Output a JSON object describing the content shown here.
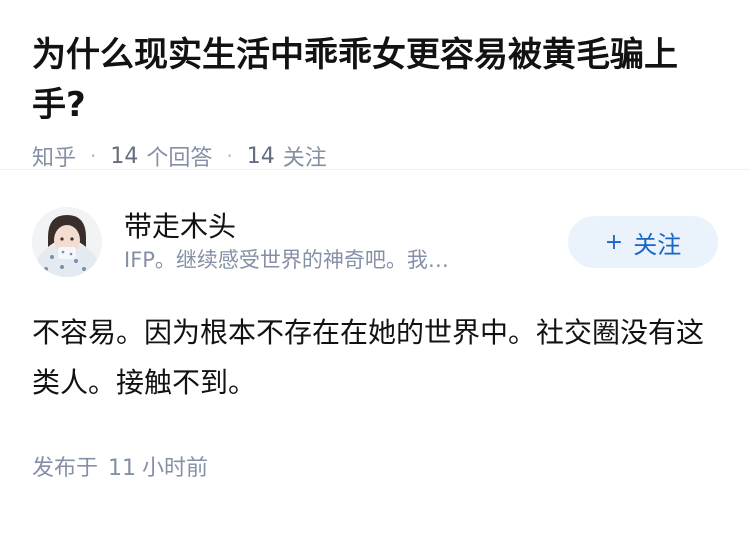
{
  "question": {
    "title": "为什么现实生活中乖乖女更容易被黄毛骗上手?",
    "source": "知乎",
    "answer_count": "14",
    "answer_label": "个回答",
    "follow_count": "14",
    "follow_label": "关注"
  },
  "answer": {
    "author_name": "带走木头",
    "author_bio": "IFP。继续感受世界的神奇吧。我…",
    "follow_button": "关注",
    "follow_icon": "+",
    "content": "不容易。因为根本不存在在她的世界中。社交圈没有这类人。接触不到。",
    "time_prefix": "发布于",
    "time_value": "11",
    "time_suffix": "小时前"
  },
  "colors": {
    "accent": "#1a66c4",
    "button_bg": "#eaf2fc",
    "meta_text": "#8590a6"
  }
}
